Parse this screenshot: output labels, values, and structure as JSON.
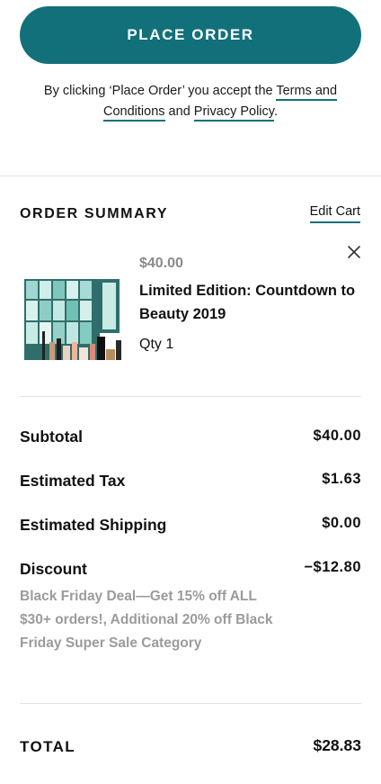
{
  "checkout": {
    "place_order_label": "PLACE ORDER",
    "terms_prefix": "By clicking ‘Place Order’ you accept the ",
    "terms_link": "Terms and Conditions",
    "terms_and": " and ",
    "privacy_link": "Privacy Policy",
    "terms_suffix": "."
  },
  "summary": {
    "title": "ORDER SUMMARY",
    "edit_cart_label": "Edit Cart",
    "item": {
      "price": "$40.00",
      "name": "Limited Edition: Countdown to Beauty 2019",
      "qty": "Qty 1",
      "image_icon": "advent-calendar-product-image",
      "remove_icon": "close-icon"
    },
    "rows": {
      "subtotal_label": "Subtotal",
      "subtotal_value": "$40.00",
      "tax_label": "Estimated Tax",
      "tax_value": "$1.63",
      "shipping_label": "Estimated Shipping",
      "shipping_value": "$0.00",
      "discount_label": "Discount",
      "discount_value": "−$12.80",
      "discount_note": "Black Friday Deal—Get 15% off ALL $30+ orders!, Additional 20% off Black Friday Super Sale Category"
    },
    "total_label": "TOTAL",
    "total_value": "$28.83"
  },
  "colors": {
    "accent": "#12707b",
    "muted": "#9b9b9b"
  }
}
